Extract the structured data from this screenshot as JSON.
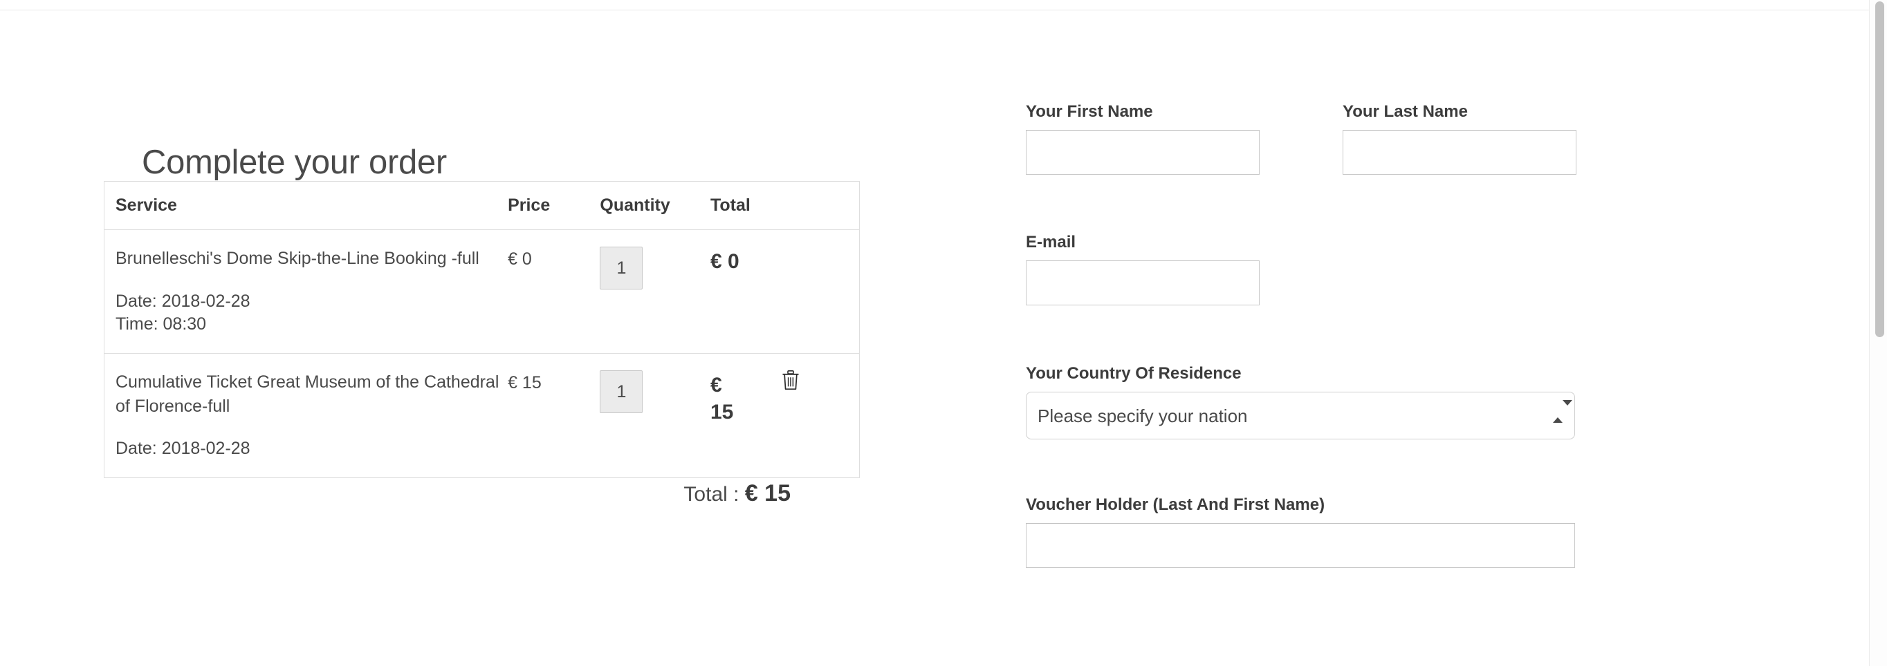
{
  "order": {
    "title": "Complete your order",
    "columns": {
      "service": "Service",
      "price": "Price",
      "quantity": "Quantity",
      "total": "Total"
    },
    "items": [
      {
        "name": "Brunelleschi's Dome Skip-the-Line Booking -full",
        "date_label": "Date: 2018-02-28",
        "time_label": "Time: 08:30",
        "price": "€ 0",
        "quantity": "1",
        "total": "€ 0",
        "has_delete": false,
        "delete_icon": "trash-icon"
      },
      {
        "name": "Cumulative Ticket Great Museum of the Cathedral of Florence-full",
        "date_label": "Date: 2018-02-28",
        "time_label": "",
        "price": "€ 15",
        "quantity": "1",
        "total": "€ 15",
        "has_delete": true,
        "delete_icon": "trash-icon"
      }
    ],
    "grand_total_label": "Total :",
    "grand_total_value": "€ 15"
  },
  "form": {
    "first_name": {
      "label": "Your First Name",
      "value": "",
      "placeholder": ""
    },
    "last_name": {
      "label": "Your Last Name",
      "value": "",
      "placeholder": ""
    },
    "email": {
      "label": "E-mail",
      "value": "",
      "placeholder": ""
    },
    "country": {
      "label": "Your Country Of Residence",
      "selected": "Please specify your nation",
      "options": [
        "Please specify your nation"
      ],
      "arrow_icon": "up-down-arrows-icon"
    },
    "voucher_holder": {
      "label": "Voucher Holder (Last And First Name)",
      "value": "",
      "placeholder": ""
    }
  },
  "colors": {
    "text": "#4a4a4a",
    "heading": "#3c3c3c",
    "border": "#dedede",
    "input_border": "#c9c9c9",
    "disabled_bg": "#ebebeb",
    "scrollbar_thumb": "#c2c2c2"
  }
}
